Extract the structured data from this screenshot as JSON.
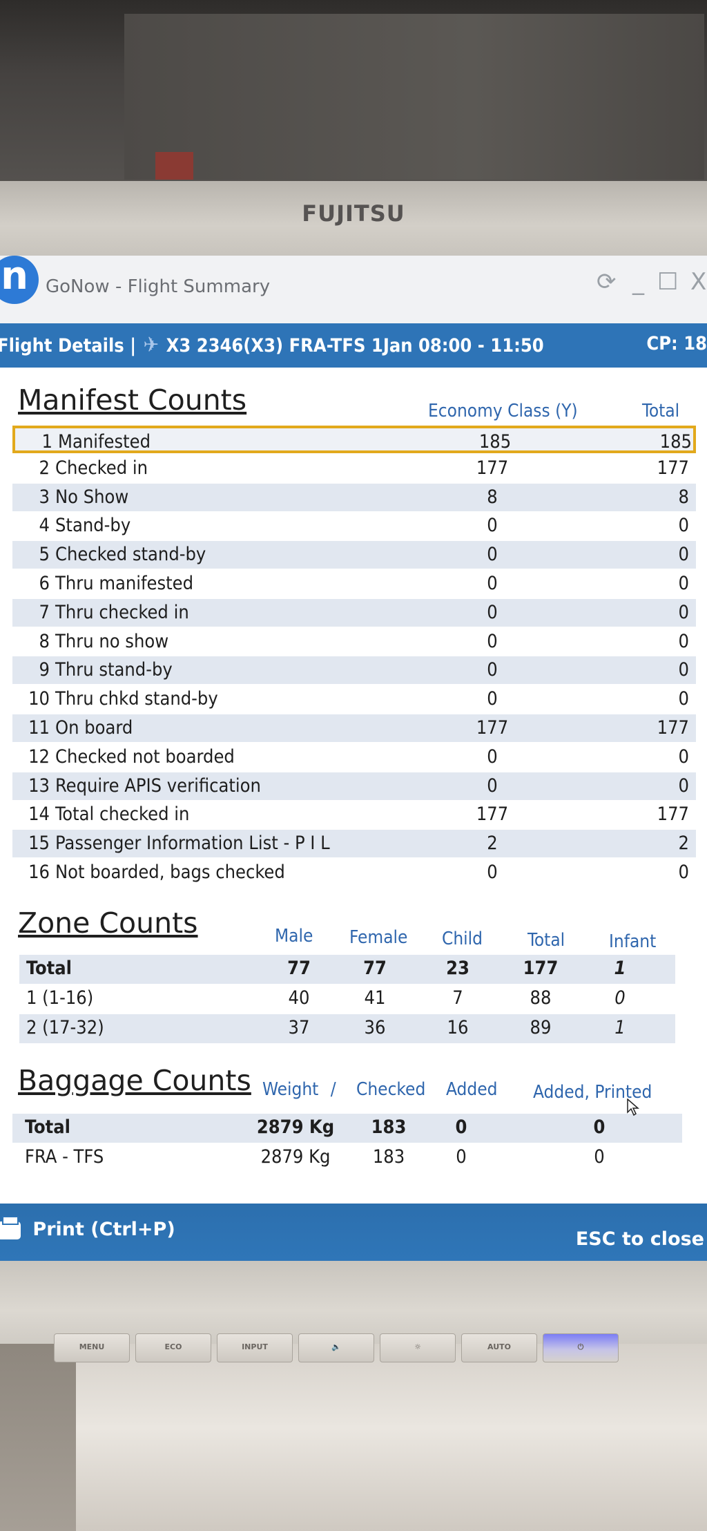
{
  "monitor": {
    "brand": "FUJITSU",
    "buttons": [
      "MENU",
      "ECO",
      "INPUT",
      "🔈",
      "☼",
      "AUTO",
      "⏻"
    ]
  },
  "window": {
    "logo": "n",
    "title": "GoNow - Flight Summary",
    "controls": {
      "refresh": "⟳",
      "minimize": "_",
      "maximize": "☐",
      "close": "X"
    }
  },
  "flight_bar": {
    "label": "Flight Details |",
    "plane_icon": "plane-icon",
    "text": "X3 2346(X3)  FRA-TFS  1Jan 08:00 - 11:50",
    "cp": "CP: 18"
  },
  "manifest": {
    "title": "Manifest Counts",
    "col_economy": "Economy Class (Y)",
    "col_total": "Total",
    "rows": [
      {
        "idx": "1",
        "label": "Manifested",
        "eco": "185",
        "total": "185"
      },
      {
        "idx": "2",
        "label": "Checked in",
        "eco": "177",
        "total": "177"
      },
      {
        "idx": "3",
        "label": "No Show",
        "eco": "8",
        "total": "8"
      },
      {
        "idx": "4",
        "label": "Stand-by",
        "eco": "0",
        "total": "0"
      },
      {
        "idx": "5",
        "label": "Checked stand-by",
        "eco": "0",
        "total": "0"
      },
      {
        "idx": "6",
        "label": "Thru manifested",
        "eco": "0",
        "total": "0"
      },
      {
        "idx": "7",
        "label": "Thru checked in",
        "eco": "0",
        "total": "0"
      },
      {
        "idx": "8",
        "label": "Thru no show",
        "eco": "0",
        "total": "0"
      },
      {
        "idx": "9",
        "label": "Thru stand-by",
        "eco": "0",
        "total": "0"
      },
      {
        "idx": "10",
        "label": "Thru chkd stand-by",
        "eco": "0",
        "total": "0"
      },
      {
        "idx": "11",
        "label": "On board",
        "eco": "177",
        "total": "177"
      },
      {
        "idx": "12",
        "label": "Checked not boarded",
        "eco": "0",
        "total": "0"
      },
      {
        "idx": "13",
        "label": "Require APIS verification",
        "eco": "0",
        "total": "0"
      },
      {
        "idx": "14",
        "label": "Total checked in",
        "eco": "177",
        "total": "177"
      },
      {
        "idx": "15",
        "label": "Passenger Information List - P I L",
        "eco": "2",
        "total": "2"
      },
      {
        "idx": "16",
        "label": "Not boarded, bags checked",
        "eco": "0",
        "total": "0"
      }
    ]
  },
  "zones": {
    "title": "Zone Counts",
    "headers": {
      "male": "Male",
      "female": "Female",
      "child": "Child",
      "total": "Total",
      "infant": "Infant"
    },
    "rows": [
      {
        "name": "Total",
        "male": "77",
        "female": "77",
        "child": "23",
        "total": "177",
        "infant": "1"
      },
      {
        "name": "1 (1-16)",
        "male": "40",
        "female": "41",
        "child": "7",
        "total": "88",
        "infant": "0"
      },
      {
        "name": "2 (17-32)",
        "male": "37",
        "female": "36",
        "child": "16",
        "total": "89",
        "infant": "1"
      }
    ]
  },
  "baggage": {
    "title": "Baggage Counts",
    "headers": {
      "weight": "Weight",
      "sep": "/",
      "checked": "Checked",
      "added": "Added",
      "printed": "Added, Printed"
    },
    "rows": [
      {
        "name": "Total",
        "weight": "2879 Kg",
        "checked": "183",
        "added": "0",
        "printed": "0"
      },
      {
        "name": "FRA - TFS",
        "weight": "2879 Kg",
        "checked": "183",
        "added": "0",
        "printed": "0"
      }
    ]
  },
  "footer": {
    "print": "Print (Ctrl+P)",
    "esc": "ESC to close"
  },
  "colors": {
    "accent": "#2e74b7",
    "header_text": "#2f66ad",
    "row_shade": "#e1e7f0",
    "selection": "#e2a91c"
  }
}
